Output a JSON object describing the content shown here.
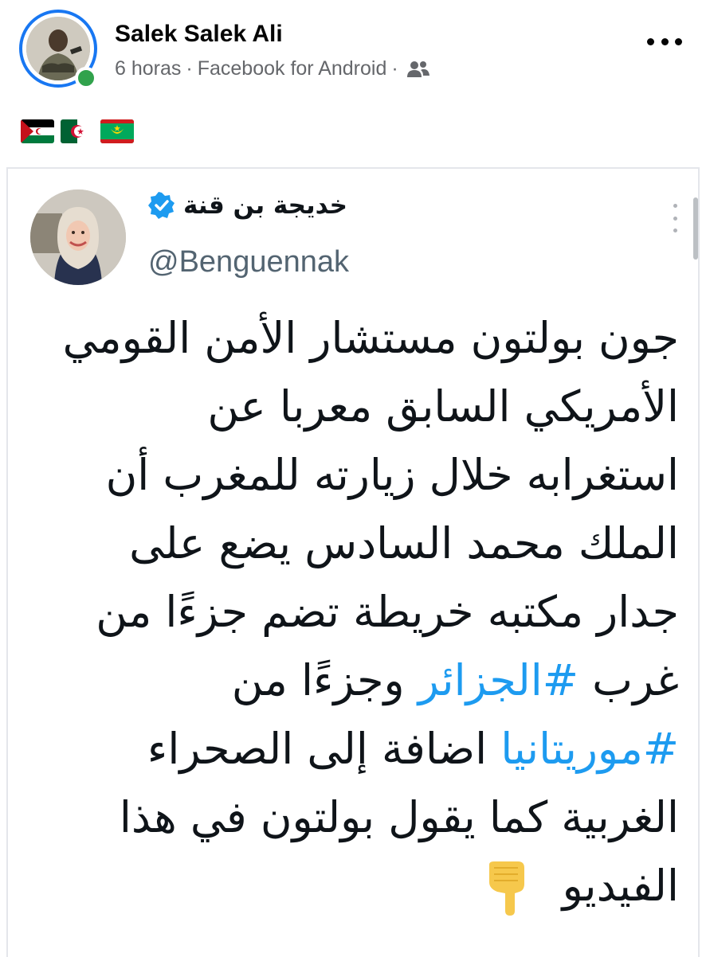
{
  "post": {
    "author_name": "Salek Salek Ali",
    "time": "6 horas",
    "separator": "·",
    "app": "Facebook for Android",
    "audience_icon": "friends-icon",
    "more_icon": "more-horizontal-icon"
  },
  "flags": [
    "flag-western-sahara",
    "flag-algeria",
    "flag-mauritania"
  ],
  "tweet": {
    "author_name": "خديجة بن قنة",
    "handle": "@Benguennak",
    "verified_icon": "verified-badge-icon",
    "lines": [
      {
        "parts": [
          {
            "text": "جون بولتون مستشار الأمن القومي"
          }
        ]
      },
      {
        "parts": [
          {
            "text": "الأمريكي السابق معربا عن"
          }
        ]
      },
      {
        "parts": [
          {
            "text": "استغرابه خلال زيارته للمغرب أن"
          }
        ]
      },
      {
        "parts": [
          {
            "text": "الملك محمد السادس يضع على"
          }
        ]
      },
      {
        "parts": [
          {
            "text": "جدار مكتبه خريطة تضم جزءًا من"
          }
        ]
      },
      {
        "parts": [
          {
            "text": "غرب "
          },
          {
            "text": "#الجزائر",
            "hashtag": true
          },
          {
            "text": " وجزءًا من"
          }
        ]
      },
      {
        "parts": [
          {
            "text": "#موريتانيا",
            "hashtag": true
          },
          {
            "text": " اضافة إلى الصحراء"
          }
        ]
      },
      {
        "parts": [
          {
            "text": "الغربية كما يقول بولتون في هذا"
          }
        ]
      },
      {
        "parts": [
          {
            "text": "الفيديو"
          }
        ],
        "pointing_icon": true
      }
    ]
  },
  "colors": {
    "fb_blue": "#1877f2",
    "online_green": "#31a24c",
    "meta_gray": "#65676b",
    "twitter_blue": "#1d9bf0",
    "tweet_text": "#0f1419"
  }
}
